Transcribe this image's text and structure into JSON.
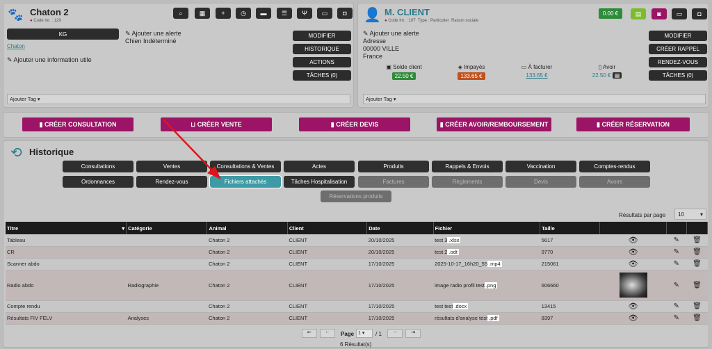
{
  "animal": {
    "name": "Chaton 2",
    "code_label": "Code Int. :",
    "code": "129",
    "weight_btn": "KG",
    "species_link": "Chaton",
    "add_alert": "Ajouter une alerte",
    "breed": "Chien Indéterminé",
    "add_info": "Ajouter une information utile",
    "tag": "Ajouter Tag",
    "buttons": [
      "MODIFIER",
      "HISTORIQUE",
      "ACTIONS",
      "TÂCHES (0)"
    ]
  },
  "client": {
    "name": "M. CLIENT",
    "code_label": "Code Int. :",
    "code": "107",
    "type_label": "Type :",
    "type": "Particulier",
    "raison": "Raison sociale",
    "balance": "0.00 €",
    "add_alert": "Ajouter une alerte",
    "address": "Adresse",
    "city": "00000 VILLE",
    "country": "France",
    "stats": [
      {
        "label": "Solde client",
        "value": "22.50 €",
        "color": "#2e8b3a"
      },
      {
        "label": "Impayés",
        "value": "133.65 €",
        "color": "#c0501e"
      },
      {
        "label": "À facturer",
        "value": "133.65 €",
        "color": ""
      },
      {
        "label": "Avoir",
        "value": "22.50 €",
        "color": ""
      }
    ],
    "tag": "Ajouter Tag",
    "buttons": [
      "MODIFIER",
      "CRÉER RAPPEL",
      "RENDEZ-VOUS",
      "TÂCHES (0)"
    ]
  },
  "actions": [
    "CRÉER CONSULTATION",
    "CRÉER VENTE",
    "CRÉER DEVIS",
    "CRÉER AVOIR/REMBOURSEMENT",
    "CRÉER RÉSERVATION"
  ],
  "historique": {
    "title": "Historique",
    "row1": [
      "Consultations",
      "Ventes",
      "Consultations & Ventes",
      "Actes",
      "Produits",
      "Rappels & Envois",
      "Vaccination",
      "Comptes-rendus"
    ],
    "row2": [
      "Ordonnances",
      "Rendez-vous",
      "Fichiers attachés",
      "Tâches Hospitalisation",
      "Factures",
      "Règlements",
      "Devis",
      "Avoirs"
    ],
    "row3": [
      "Réservations produits"
    ],
    "results_label": "Résultats par page",
    "results_value": "10"
  },
  "table": {
    "headers": [
      "Titre",
      "Catégorie",
      "Animal",
      "Client",
      "Date",
      "Fichier",
      "Taille",
      "",
      "",
      ""
    ],
    "rows": [
      {
        "titre": "Tableau",
        "cat": "",
        "animal": "Chaton 2",
        "client": "CLIENT",
        "date": "20/10/2025",
        "file": "test 3",
        "ext": ".xlsx",
        "size": "5617"
      },
      {
        "titre": "CR",
        "cat": "",
        "animal": "Chaton 2",
        "client": "CLIENT",
        "date": "20/10/2025",
        "file": "test 2",
        "ext": ".odt",
        "size": "9770"
      },
      {
        "titre": "Scanner abdo",
        "cat": "",
        "animal": "Chaton 2",
        "client": "CLIENT",
        "date": "17/10/2025",
        "file": "2025-10-17_16h20_55",
        "ext": ".mp4",
        "size": "215061"
      },
      {
        "titre": "Radio abdo",
        "cat": "Radiographie",
        "animal": "Chaton 2",
        "client": "CLIENT",
        "date": "17/10/2025",
        "file": "image radio profil test",
        "ext": ".png",
        "size": "606660"
      },
      {
        "titre": "Compte rendu",
        "cat": "",
        "animal": "Chaton 2",
        "client": "CLIENT",
        "date": "17/10/2025",
        "file": "test test",
        "ext": ".docx",
        "size": "13415"
      },
      {
        "titre": "Résultats FIV FELV",
        "cat": "Analyses",
        "animal": "Chaton 2",
        "client": "CLIENT",
        "date": "17/10/2025",
        "file": "résultats d'analyse test",
        "ext": ".pdf",
        "size": "8397"
      }
    ]
  },
  "pagination": {
    "page_label": "Page",
    "page": "1",
    "of": "/ 1",
    "count": "6 Résultat(s)"
  },
  "colors": {
    "accent": "#9b1466",
    "teal": "#2a7a88",
    "active": "#3e9aa4",
    "arrow": "#e0151b"
  }
}
